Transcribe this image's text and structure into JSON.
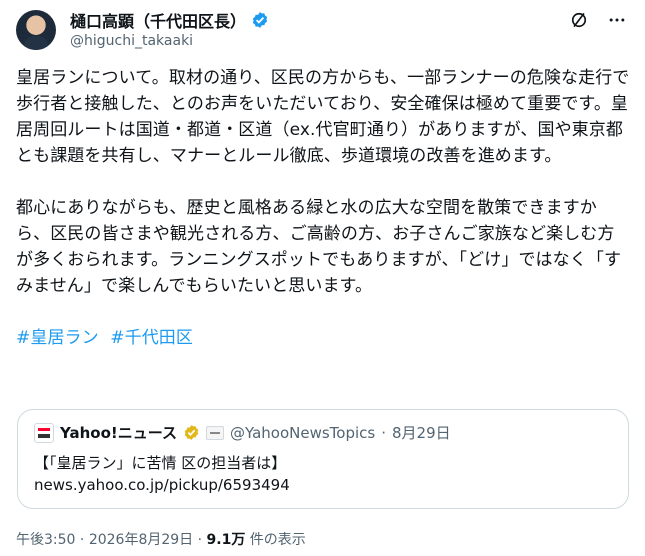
{
  "author": {
    "name": "樋口高顕（千代田区長）",
    "handle": "@higuchi_takaaki",
    "verified_color": "#1d9bf0"
  },
  "tweet": {
    "paragraphs": [
      "皇居ランについて。取材の通り、区民の方からも、一部ランナーの危険な走行で歩行者と接触した、とのお声をいただいており、安全確保は極めて重要です。皇居周回ルートは国道・都道・区道（ex.代官町通り）がありますが、国や東京都とも課題を共有し、マナーとルール徹底、歩道環境の改善を進めます。",
      "都心にありながらも、歴史と風格ある緑と水の広大な空間を散策できますから、区民の皆さまや観光される方、ご高齢の方、お子さんご家族など楽しむ方が多くおられます。ランニングスポットでもありますが、「どけ」ではなく「すみません」で楽しんでもらいたいと思います。"
    ],
    "hashtags": [
      "#皇居ラン",
      "#千代田区"
    ],
    "link_color": "#1d9bf0"
  },
  "quote_card": {
    "source_name": "Yahoo!ニュース",
    "source_handle": "@YahooNewsTopics",
    "date": "8月29日",
    "separator": "·",
    "title": "【「皇居ラン」に苦情 区の担当者は】",
    "url": "news.yahoo.co.jp/pickup/6593494",
    "badge_color": "#e2b719"
  },
  "footer": {
    "time": "午後3:50",
    "date": "2026年8月29日",
    "separator": "·",
    "views": "9.1万",
    "views_label": "件の表示"
  },
  "icons": {
    "grok": "slash-circle-icon",
    "more": "more-icon"
  }
}
